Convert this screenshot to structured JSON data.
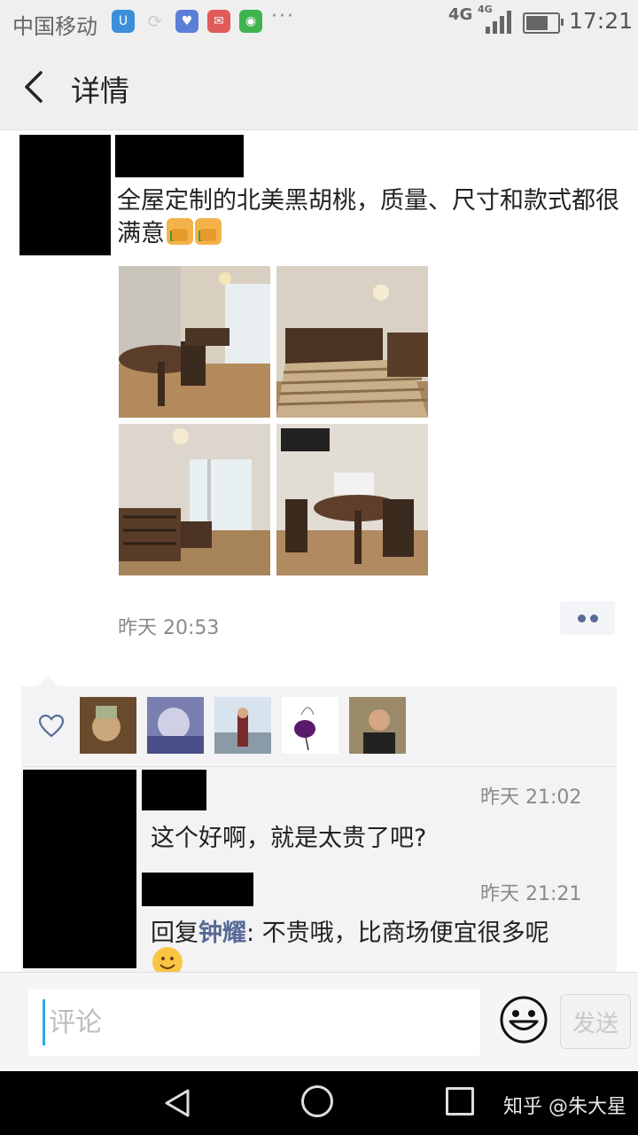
{
  "status_bar": {
    "carrier": "中国移动",
    "network_1": "4G",
    "network_2": "4G",
    "time": "17:21",
    "more": "···"
  },
  "nav": {
    "title": "详情"
  },
  "post": {
    "text": "全屋定制的北美黑胡桃，质量、尺寸和款式都很满意",
    "time": "昨天 20:53"
  },
  "comments": [
    {
      "time": "昨天 21:02",
      "text": "这个好啊，就是太贵了吧?"
    },
    {
      "time": "昨天 21:21",
      "reply_prefix": "回复",
      "reply_to": "钟耀",
      "text": ": 不贵哦，比商场便宜很多呢"
    }
  ],
  "input": {
    "placeholder": "评论",
    "send_label": "发送"
  },
  "watermark": "知乎 @朱大星",
  "colors": {
    "link_blue": "#576b95",
    "panel_bg": "#f3f3f5",
    "bar_bg": "#efefef"
  }
}
